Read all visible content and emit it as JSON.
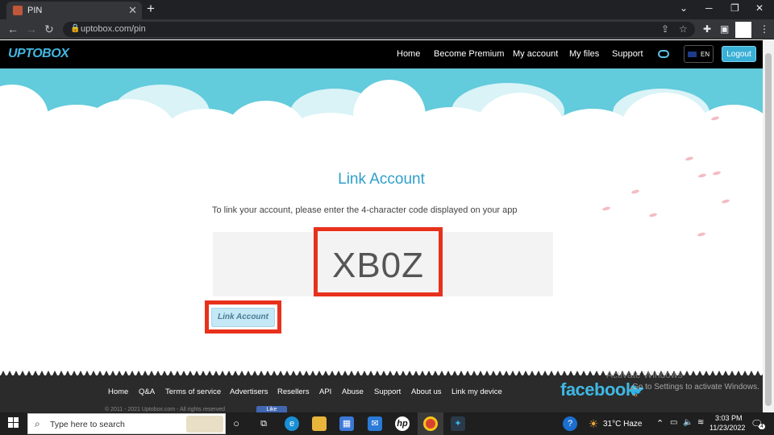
{
  "browser": {
    "tab_title": "PIN",
    "tab_close": "✕",
    "new_tab": "+",
    "url": "uptobox.com/pin",
    "window_controls": [
      "⌄",
      "─",
      "❐",
      "✕"
    ]
  },
  "site": {
    "logo": "UPTOBOX",
    "nav": [
      "Home",
      "Become Premium",
      "My account",
      "My files",
      "Support"
    ],
    "language": "EN",
    "logout_label": "Logout"
  },
  "page": {
    "heading": "Link Account",
    "instruction": "To link your account, please enter the 4-character code displayed on your app",
    "code": "XB0Z",
    "button_label": "Link Account"
  },
  "footer": {
    "links": [
      "Home",
      "Q&A",
      "Terms of service",
      "Advertisers",
      "Resellers",
      "API",
      "Abuse",
      "Support",
      "About us",
      "Link my device"
    ],
    "copyright": "© 2011 - 2021 Uptobox.com - All rights reserved",
    "like_label": "Like",
    "facebook": "facebook",
    "activate_title": "Activate Windows",
    "activate_sub": "Go to Settings to activate Windows."
  },
  "taskbar": {
    "search_placeholder": "Type here to search",
    "weather": "31°C  Haze",
    "time": "3:03 PM",
    "date": "11/23/2022",
    "notification_count": "4"
  },
  "colors": {
    "accent": "#2f9fcb",
    "highlight_frame": "#e8311c",
    "header_bg": "#000000",
    "sky": "#62cbdc"
  }
}
